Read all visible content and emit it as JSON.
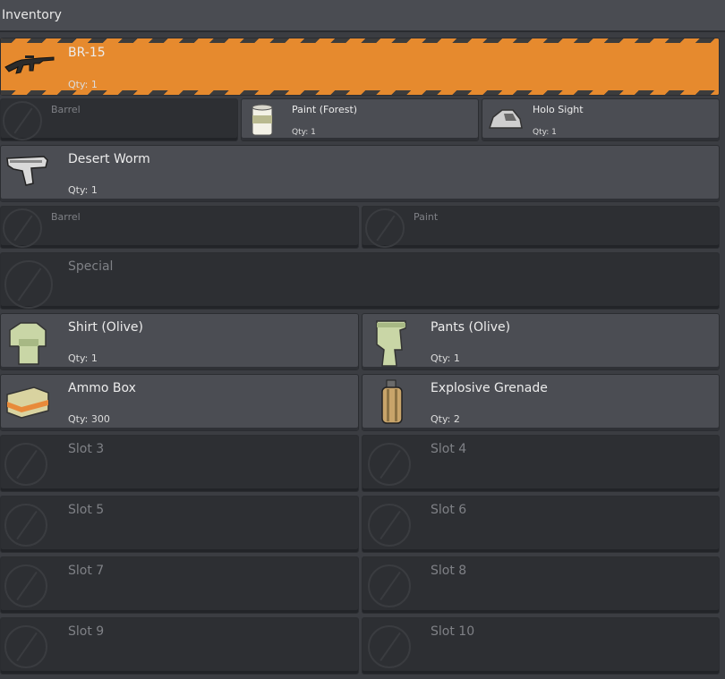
{
  "window": {
    "title": "Inventory"
  },
  "weapons": [
    {
      "name": "BR-15",
      "qty": "Qty: 1",
      "icon": "rifle-icon",
      "selected": true
    },
    {
      "name": "Desert Worm",
      "qty": "Qty: 1",
      "icon": "pistol-icon"
    }
  ],
  "attachments_br15": [
    {
      "name": "Barrel",
      "qty": "",
      "icon": "barrel-empty-icon",
      "empty": true
    },
    {
      "name": "Paint (Forest)",
      "qty": "Qty: 1",
      "icon": "paint-can-icon"
    },
    {
      "name": "Holo Sight",
      "qty": "Qty: 1",
      "icon": "holo-sight-icon"
    }
  ],
  "attachments_desert_worm": [
    {
      "name": "Barrel",
      "icon": "barrel-empty-icon",
      "empty": true
    },
    {
      "name": "Paint",
      "icon": "paint-empty-icon",
      "empty": true
    }
  ],
  "special": {
    "name": "Special",
    "icon": "special-empty-icon",
    "empty": true
  },
  "gear": [
    {
      "name": "Shirt (Olive)",
      "qty": "Qty: 1",
      "icon": "shirt-icon"
    },
    {
      "name": "Pants (Olive)",
      "qty": "Qty: 1",
      "icon": "pants-icon"
    },
    {
      "name": "Ammo Box",
      "qty": "Qty: 300",
      "icon": "ammo-box-icon"
    },
    {
      "name": "Explosive Grenade",
      "qty": "Qty: 2",
      "icon": "grenade-icon"
    }
  ],
  "empty_slots": [
    "Slot 3",
    "Slot 4",
    "Slot 5",
    "Slot 6",
    "Slot 7",
    "Slot 8",
    "Slot 9",
    "Slot 10"
  ],
  "colors": {
    "selected": "#e68a2e",
    "filled": "#4b4d53",
    "empty": "#2d2f33",
    "background": "#3b3d42"
  }
}
